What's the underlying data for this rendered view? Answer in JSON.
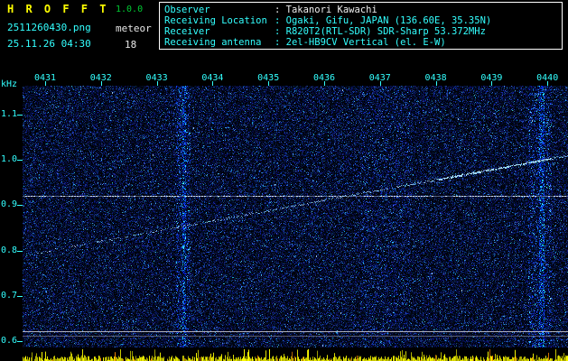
{
  "header": {
    "title": "H R O F F T",
    "version": "1.0.0",
    "filename": "2511260430.png",
    "mode": "meteor",
    "datetime": "25.11.26 04:30",
    "count": "18"
  },
  "info_panel": {
    "rows": [
      {
        "label": "Observer",
        "value": ": Takanori Kawachi"
      },
      {
        "label": "Receiving Location",
        "value": ": Ogaki, Gifu, JAPAN (136.60E, 35.35N)"
      },
      {
        "label": "Receiver",
        "value": ": R820T2(RTL-SDR) SDR-Sharp 53.372MHz"
      },
      {
        "label": "Receiving antenna",
        "value": ": 2el-HB9CV Vertical (el. E-W)"
      }
    ]
  },
  "colors": {
    "title_yellow": "#FFFF00",
    "version_green": "#00CC33",
    "axis_cyan": "#33FFFF",
    "text_white": "#E8E8E8",
    "panel_border": "#FFFFFF",
    "noise_blue": "#2244CC",
    "trace_cyan": "#88CCFF",
    "level_bar_yellow": "#CCCC00"
  },
  "chart_data": {
    "type": "heatmap",
    "title": "HROFFT 10-minute radio meteor spectrogram, 25.11.26 04:30-04:40",
    "description": "Waterfall of FFT spectra: dark blue noise field, a slowly rising carrier trace, one horizontal reference line mid-band and two faint horizontal lines near the bottom, with a yellow signal-level bar meter under the plot.",
    "ylabel": "kHz",
    "x_ticks": [
      "0431",
      "0432",
      "0433",
      "0434",
      "0435",
      "0436",
      "0437",
      "0438",
      "0439",
      "0440"
    ],
    "x_span": "04:30 - 04:40",
    "y_ticks": [
      "1.1",
      "1.0",
      "0.9",
      "0.8",
      "0.7",
      "0.6"
    ],
    "y_range_khz": [
      0.586,
      1.164
    ],
    "carrier_trace": {
      "start_time": "04:30",
      "start_khz": 0.79,
      "end_time": "04:40",
      "end_khz": 1.01
    },
    "reference_line_khz": 0.92,
    "horizontal_lines_khz": [
      0.622,
      0.612
    ],
    "meteor_count": 18,
    "legend": "off",
    "grid": "off"
  }
}
